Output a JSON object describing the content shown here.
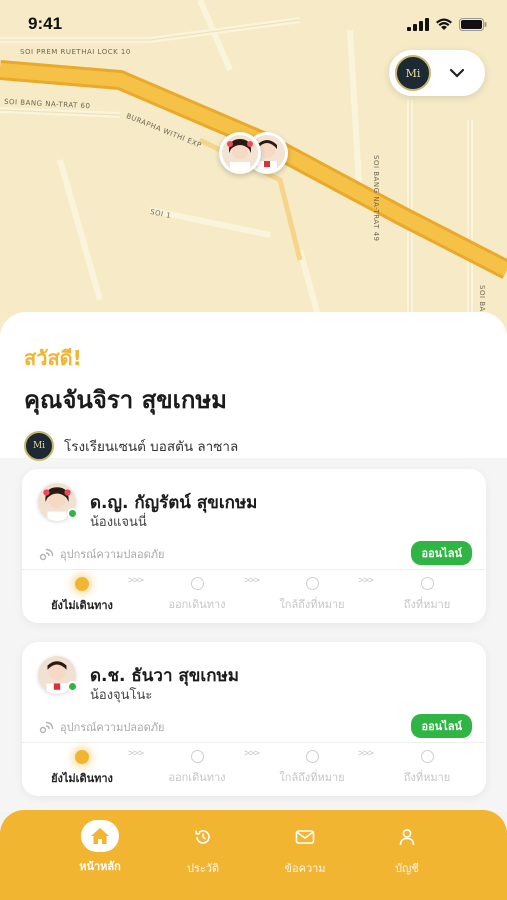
{
  "status_bar": {
    "time": "9:41"
  },
  "map": {
    "roads": {
      "prem_ruethai": "SOI PREM RUETHAI LOCK 10",
      "bang_na_trat_60": "SOI BANG NA-TRAT 60",
      "burapha": "BURAPHA WITHI EXP",
      "soi_1": "SOI 1",
      "bang_na_trat_49": "SOI BANG NA-TRAT 49",
      "soi_bang_edge": "SOI BANG"
    },
    "school_logo_text": "Mi"
  },
  "greeting": {
    "hello": "สวัสดี!",
    "name": "คุณจันจิรา สุขเกษม"
  },
  "school": {
    "name": "โรงเรียนเซนต์ บอสตัน ลาซาล",
    "logo_text": "Mi"
  },
  "children": [
    {
      "name": "ด.ญ. กัญรัตน์ สุขเกษม",
      "nickname": "น้องแจนนี่",
      "device_label": "อุปกรณ์ความปลอดภัย",
      "status": "ออนไลน์",
      "steps": [
        "ยังไม่เดินทาง",
        "ออกเดินทาง",
        "ใกล้ถึงที่หมาย",
        "ถึงที่หมาย"
      ],
      "active_step": 0
    },
    {
      "name": "ด.ช. ธันวา สุขเกษม",
      "nickname": "น้องจุนโนะ",
      "device_label": "อุปกรณ์ความปลอดภัย",
      "status": "ออนไลน์",
      "steps": [
        "ยังไม่เดินทาง",
        "ออกเดินทาง",
        "ใกล้ถึงที่หมาย",
        "ถึงที่หมาย"
      ],
      "active_step": 0
    }
  ],
  "step_arrow": ">>>",
  "tabs": [
    {
      "label": "หน้าหลัก",
      "icon": "home-icon",
      "active": true
    },
    {
      "label": "ประวัติ",
      "icon": "history-icon",
      "active": false
    },
    {
      "label": "ข้อความ",
      "icon": "mail-icon",
      "active": false
    },
    {
      "label": "บัญชี",
      "icon": "user-icon",
      "active": false
    }
  ],
  "colors": {
    "accent": "#f2b531",
    "online": "#2fb544",
    "map_bg": "#f6ebc6",
    "road": "#f2b531"
  }
}
